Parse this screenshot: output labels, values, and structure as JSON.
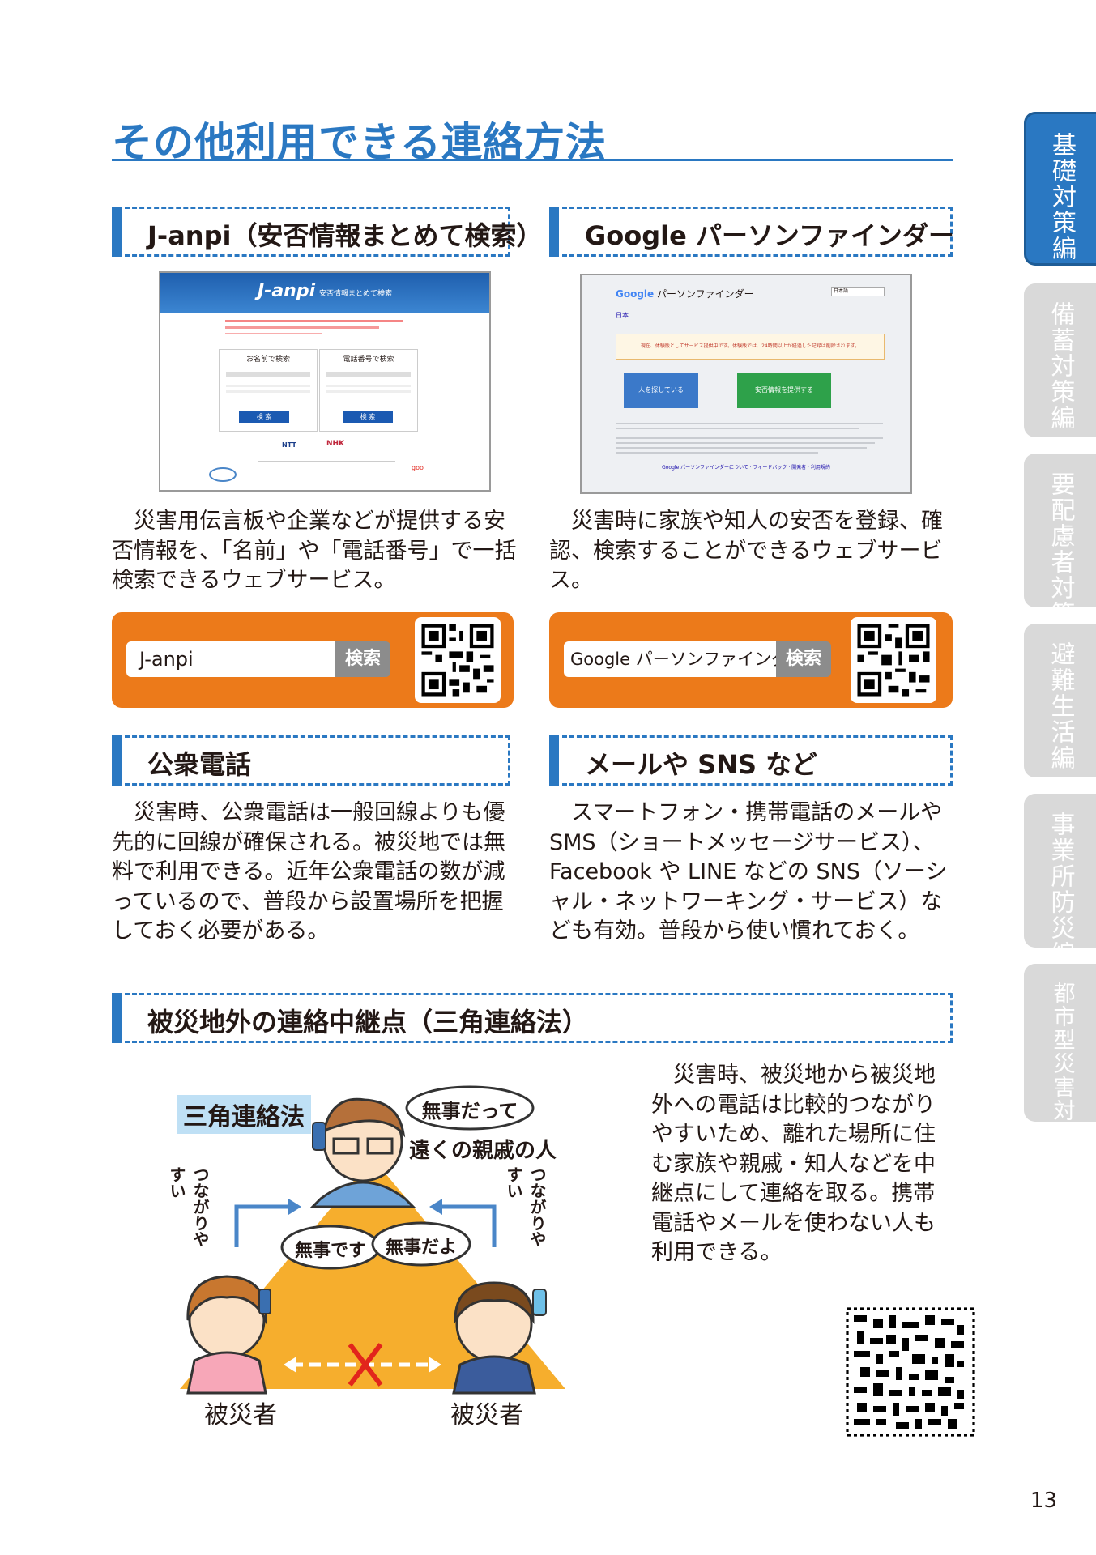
{
  "page": {
    "title": "その他利用できる連絡方法",
    "page_number": "13"
  },
  "side_tabs": [
    {
      "label": "基礎対策編",
      "active": true
    },
    {
      "label": "備蓄対策編",
      "active": false
    },
    {
      "label": "要配慮者対策編",
      "active": false
    },
    {
      "label": "避難生活編",
      "active": false
    },
    {
      "label": "事業所防災編",
      "active": false
    },
    {
      "label": "都市型災害対策編",
      "active": false
    }
  ],
  "colors": {
    "accent_blue": "#2a78c2",
    "orange": "#ec7a1a",
    "tab_active": "#2a78c2",
    "tab_inactive": "#d9d9d9"
  },
  "janpi": {
    "heading": "J-anpi（安否情報まとめて検索）",
    "description": "災害用伝言板や企業などが提供する安否情報を、「名前」や「電話番号」で一括検索できるウェブサービス。",
    "search_value": "J-anpi",
    "search_button": "検索",
    "screenshot": {
      "logo": "J-anpi",
      "tagline": "安否情報まとめて検索",
      "box_left_title": "お名前で検索",
      "box_right_title": "電話番号で検索",
      "button": "検 索",
      "footer_ntt": "NTT",
      "footer_nhk": "NHK",
      "footer_goo": "goo"
    }
  },
  "google": {
    "heading": "Google パーソンファインダー",
    "description": "災害時に家族や知人の安否を登録、確認、検索することができるウェブサービス。",
    "search_value": "Google パーソンファインダー",
    "search_button": "検索",
    "screenshot": {
      "logo_google": "Google",
      "logo_rest": "パーソンファインダー",
      "region": "日本",
      "select": "日本語",
      "alert": "現在、体験版としてサービス提供中です。体験版では、24時間以上が経過した記録は削除されます。",
      "btn_search": "人を探している",
      "btn_provide": "安否情報を提供する",
      "footer_link": "Google パーソンファインダーについて · フィードバック · 開発者 · 利用規約"
    }
  },
  "public_phone": {
    "heading": "公衆電話",
    "description": "災害時、公衆電話は一般回線よりも優先的に回線が確保される。被災地では無料で利用できる。近年公衆電話の数が減っているので、普段から設置場所を把握しておく必要がある。"
  },
  "mail_sns": {
    "heading": "メールや SNS など",
    "description": "スマートフォン・携帯電話のメールや SMS（ショートメッセージサービス）、Facebook や LINE などの SNS（ソーシャル・ネットワーキング・サービス）なども有効。普段から使い慣れておく。"
  },
  "triangle": {
    "heading": "被災地外の連絡中継点（三角連絡法）",
    "description": "災害時、被災地から被災地外への電話は比較的つながりやすいため、離れた場所に住む家族や親戚・知人などを中継点にして連絡を取る。携帯電話やメールを使わない人も利用できる。",
    "illustration": {
      "label": "三角連絡法",
      "bubble_top_1": "無事だって",
      "top_person": "遠くの親戚の人",
      "bubble_left": "無事です",
      "bubble_right": "無事だよ",
      "arrow_left": "つながりやすい",
      "arrow_right": "つながりやすい",
      "victim_left": "被災者",
      "victim_right": "被災者"
    }
  }
}
